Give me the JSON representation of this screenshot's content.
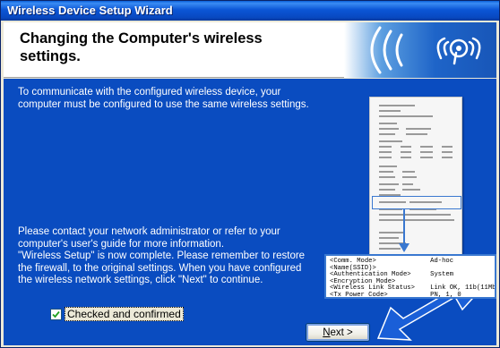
{
  "window": {
    "title": "Wireless Device Setup Wizard"
  },
  "header": {
    "title": "Changing the Computer's wireless settings.",
    "banner_icon": "wireless-signal-icon"
  },
  "content": {
    "paragraph1": "To communicate with the configured wireless device, your computer must be configured to use the same wireless settings.",
    "paragraph2_line1": "Please contact your network administrator or refer to your computer's user's guide for more information.",
    "paragraph2_line2": "\"Wireless Setup\" is now complete. Please remember to restore the firewall, to the original settings. When you have configured the wireless network settings, click \"Next\" to continue.",
    "zoom_text": "<Comm. Mode>              Ad-hoc\n<Name(SSID)>\n<Authentication Mode>     System\n<Encryption Mode>\n<Wireless Link Status>    Link OK, 11b(11Mb\n<Tx Power Code>           PN, 1, 0"
  },
  "checkbox": {
    "label": "Checked and confirmed",
    "checked": true
  },
  "buttons": {
    "next_underlined": "N",
    "next_rest": "ext >"
  },
  "colors": {
    "content_bg": "#0a4cc0",
    "title_bar": "#0b56d6",
    "arrow": "#1a5fd8"
  }
}
